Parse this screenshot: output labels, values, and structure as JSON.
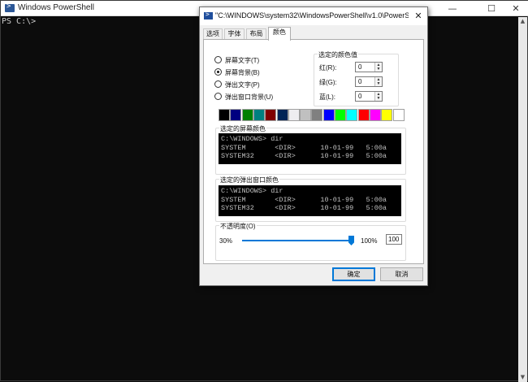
{
  "window": {
    "title": "Windows PowerShell",
    "controls": {
      "minimize": "—",
      "maximize": "☐",
      "close": "✕"
    }
  },
  "console": {
    "lines": [
      "PS C:\\>"
    ]
  },
  "dialog": {
    "title": "\"C:\\WINDOWS\\system32\\WindowsPowerShell\\v1.0\\PowerShell.exe...",
    "close": "✕",
    "tabs": [
      {
        "label": "选项",
        "active": false
      },
      {
        "label": "字体",
        "active": false
      },
      {
        "label": "布局",
        "active": false
      },
      {
        "label": "颜色",
        "active": true
      }
    ],
    "radios": [
      {
        "label": "屏幕文字(T)",
        "checked": false
      },
      {
        "label": "屏幕背景(B)",
        "checked": true
      },
      {
        "label": "弹出文字(P)",
        "checked": false
      },
      {
        "label": "弹出窗口背景(U)",
        "checked": false
      }
    ],
    "selected_color": {
      "label": "选定的颜色值",
      "red_label": "红(R):",
      "red_value": "0",
      "green_label": "绿(G):",
      "green_value": "0",
      "blue_label": "蓝(L):",
      "blue_value": "0"
    },
    "palette": [
      "#000000",
      "#000080",
      "#008000",
      "#008080",
      "#800000",
      "#012456",
      "#eeedf0",
      "#c0c0c0",
      "#808080",
      "#0000ff",
      "#00ff00",
      "#00ffff",
      "#ff0000",
      "#ff00ff",
      "#ffff00",
      "#ffffff"
    ],
    "screen_preview": {
      "label": "选定的屏幕颜色",
      "text": "C:\\WINDOWS> dir\nSYSTEM       <DIR>      10-01-99   5:00a\nSYSTEM32     <DIR>      10-01-99   5:00a"
    },
    "popup_preview": {
      "label": "选定的弹出窗口颜色",
      "text": "C:\\WINDOWS> dir\nSYSTEM       <DIR>      10-01-99   5:00a\nSYSTEM32     <DIR>      10-01-99   5:00a"
    },
    "opacity": {
      "label": "不透明度(O)",
      "min_label": "30%",
      "max_label": "100%",
      "value": "100",
      "level": 1.0
    },
    "buttons": {
      "ok": "确定",
      "cancel": "取消"
    }
  }
}
